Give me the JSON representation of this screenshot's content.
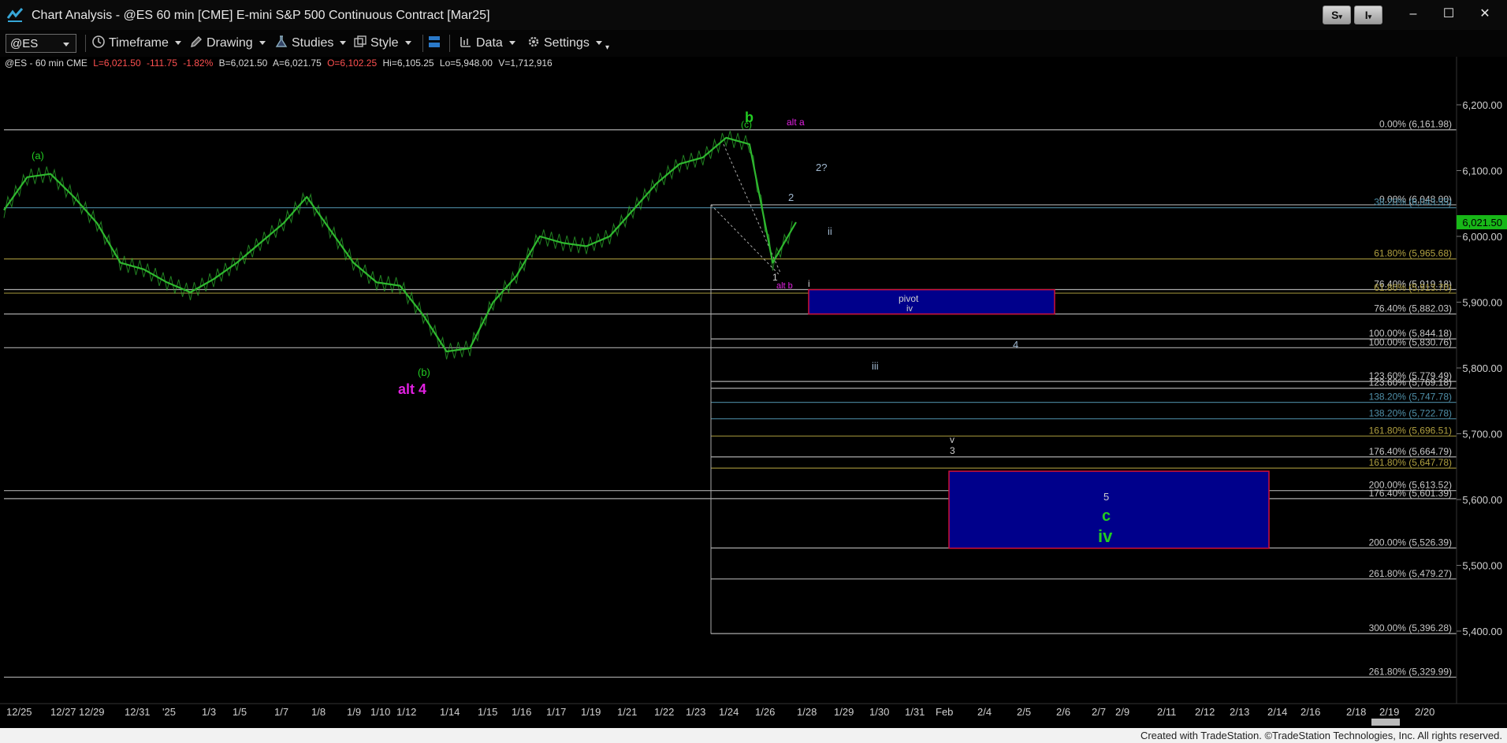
{
  "window": {
    "title": "Chart Analysis - @ES 60 min [CME] E-mini S&P 500 Continuous Contract [Mar25]",
    "btn_s": "S",
    "btn_i": "I",
    "minimize": "–",
    "maximize": "☐",
    "close": "✕"
  },
  "toolbar": {
    "symbol": "@ES",
    "timeframe": "Timeframe",
    "drawing": "Drawing",
    "studies": "Studies",
    "style": "Style",
    "data": "Data",
    "settings": "Settings"
  },
  "legend": {
    "name": "@ES - 60 min  CME",
    "last": "L=6,021.50",
    "change": "-111.75",
    "pct": "-1.82%",
    "bid": "B=6,021.50",
    "ask": "A=6,021.75",
    "open": "O=6,102.25",
    "high": "Hi=6,105.25",
    "low": "Lo=5,948.00",
    "volume": "V=1,712,916"
  },
  "price_axis": {
    "ticks": [
      "6,200.00",
      "6,100.00",
      "6,000.00",
      "5,900.00",
      "5,800.00",
      "5,700.00",
      "5,600.00",
      "5,500.00",
      "5,400.00"
    ],
    "last_price_tag": "6,021.50"
  },
  "time_axis": {
    "labels": [
      "12/25",
      "12/27",
      "12/29",
      "12/31",
      "'25",
      "1/3",
      "1/5",
      "1/7",
      "1/8",
      "1/9",
      "1/10",
      "1/12",
      "1/14",
      "1/15",
      "1/16",
      "1/17",
      "1/19",
      "1/21",
      "1/22",
      "1/23",
      "1/24",
      "1/26",
      "1/28",
      "1/29",
      "1/30",
      "1/31",
      "Feb",
      "2/4",
      "2/5",
      "2/6",
      "2/7",
      "2/9",
      "2/11",
      "2/12",
      "2/13",
      "2/14",
      "2/16",
      "2/18",
      "2/19",
      "2/20"
    ]
  },
  "fib_labels": [
    {
      "text": "0.00% (6,161.98)",
      "color": "#c8c8c8"
    },
    {
      "text": "0.00% (6,048.00)",
      "color": "#c8c8c8"
    },
    {
      "text": "38.20% (6,043.55)",
      "color": "#4f8fa8"
    },
    {
      "text": "61.80% (5,965.68)",
      "color": "#b0a040"
    },
    {
      "text": "76.40% (5,919.18)",
      "color": "#c8c8c8"
    },
    {
      "text": "61.80% (5,913.70)",
      "color": "#b0a040"
    },
    {
      "text": "76.40% (5,882.03)",
      "color": "#c8c8c8"
    },
    {
      "text": "100.00% (5,844.18)",
      "color": "#c8c8c8"
    },
    {
      "text": "100.00% (5,830.76)",
      "color": "#c8c8c8"
    },
    {
      "text": "123.60% (5,779.49)",
      "color": "#c8c8c8"
    },
    {
      "text": "123.60% (5,769.18)",
      "color": "#c8c8c8"
    },
    {
      "text": "138.20% (5,747.78)",
      "color": "#4f8fa8"
    },
    {
      "text": "138.20% (5,722.78)",
      "color": "#4f8fa8"
    },
    {
      "text": "161.80% (5,696.51)",
      "color": "#b0a040"
    },
    {
      "text": "176.40% (5,664.79)",
      "color": "#c8c8c8"
    },
    {
      "text": "161.80% (5,647.78)",
      "color": "#b0a040"
    },
    {
      "text": "200.00% (5,613.52)",
      "color": "#c8c8c8"
    },
    {
      "text": "176.40% (5,601.39)",
      "color": "#c8c8c8"
    },
    {
      "text": "200.00% (5,526.39)",
      "color": "#c8c8c8"
    },
    {
      "text": "261.80% (5,479.27)",
      "color": "#c8c8c8"
    },
    {
      "text": "300.00% (5,396.28)",
      "color": "#c8c8c8"
    },
    {
      "text": "261.80% (5,329.99)",
      "color": "#c8c8c8"
    }
  ],
  "annotations": {
    "a_paren": "(a)",
    "b_paren": "(b)",
    "c_paren": "(c)",
    "b_wave": "b",
    "alt_a": "alt a",
    "alt_b": "alt b",
    "alt_4": "alt 4",
    "two_q": "2?",
    "two": "2",
    "one": "1",
    "i": "i",
    "ii": "ii",
    "iii": "iii",
    "pivot": "pivot",
    "iv_small": "iv",
    "four": "4",
    "v": "v",
    "three": "3",
    "five": "5",
    "c": "c",
    "iv_big": "iv"
  },
  "chart_data": {
    "type": "line",
    "symbol": "@ES",
    "interval": "60 min",
    "y_range": [
      5300,
      6260
    ],
    "series": [
      {
        "name": "@ES",
        "x": [
          "12/24",
          "12/25",
          "12/26",
          "12/27",
          "12/28",
          "12/29",
          "12/30",
          "12/31",
          "1/1",
          "1/2",
          "1/3",
          "1/4",
          "1/5",
          "1/6",
          "1/7",
          "1/8",
          "1/9",
          "1/10",
          "1/11",
          "1/12",
          "1/13",
          "1/14",
          "1/15",
          "1/16",
          "1/17",
          "1/18",
          "1/19",
          "1/20",
          "1/21",
          "1/22",
          "1/23",
          "1/24",
          "1/25",
          "1/26",
          "1/27"
        ],
        "values": [
          6040,
          6090,
          6095,
          6060,
          6020,
          5960,
          5950,
          5930,
          5915,
          5935,
          5960,
          5990,
          6020,
          6060,
          6010,
          5960,
          5930,
          5925,
          5880,
          5825,
          5830,
          5900,
          5940,
          6000,
          5990,
          5985,
          6000,
          6040,
          6080,
          6110,
          6120,
          6150,
          6140,
          5960,
          6021.5
        ]
      }
    ],
    "colors": {
      "price": "#2fb82f",
      "zone": "#00008b",
      "zone_border": "#d0103a",
      "magenta": "#e020e0",
      "green_label": "#22cc22"
    }
  },
  "footer": {
    "credit": "Created with TradeStation. ©TradeStation Technologies, Inc. All rights reserved."
  }
}
